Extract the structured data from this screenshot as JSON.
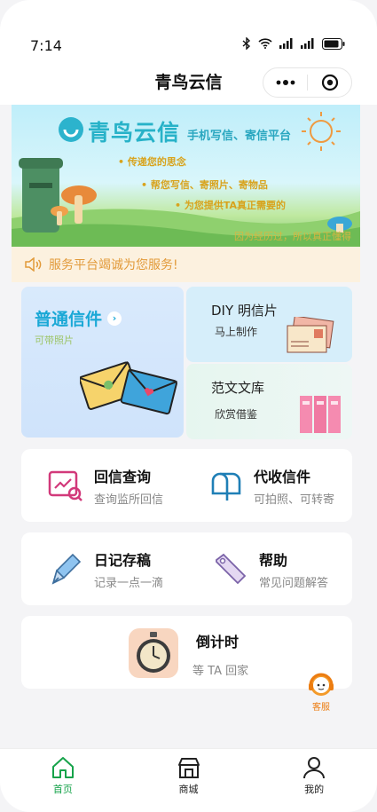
{
  "status": {
    "time": "7:14"
  },
  "nav": {
    "title": "青鸟云信"
  },
  "banner": {
    "brand": "青鸟云信",
    "slogan": "手机写信、寄信平台",
    "bullets": [
      "传递您的思念",
      "帮您写信、寄照片、寄物品",
      "为您提供TA真正需要的"
    ],
    "tagline": "因为经历过，所以真正懂得"
  },
  "notice": {
    "text": "服务平台竭诚为您服务!"
  },
  "grid": {
    "big": {
      "title": "普通信件",
      "sub": "可带照片"
    },
    "diy": {
      "title": "DIY 明信片",
      "sub": "马上制作"
    },
    "fanwen": {
      "title": "范文文库",
      "sub": "欣赏借鉴"
    }
  },
  "row1": [
    {
      "title": "回信查询",
      "sub": "查询监所回信",
      "icon": "search-reply-icon"
    },
    {
      "title": "代收信件",
      "sub": "可拍照、可转寄",
      "icon": "mailbox-icon"
    }
  ],
  "row2": [
    {
      "title": "日记存稿",
      "sub": "记录一点一滴",
      "icon": "pen-icon"
    },
    {
      "title": "帮助",
      "sub": "常见问题解答",
      "icon": "tag-icon"
    }
  ],
  "countdown": {
    "title": "倒计时",
    "sub": "等 TA 回家"
  },
  "kefu": {
    "label": "客服"
  },
  "tabbar": [
    {
      "label": "首页",
      "active": true
    },
    {
      "label": "商城",
      "active": false
    },
    {
      "label": "我的",
      "active": false
    }
  ],
  "colors": {
    "accent": "#16a34a",
    "notice": "#e29a3a",
    "kefu": "#ec7d12",
    "title_blue": "#1aa8d6"
  }
}
